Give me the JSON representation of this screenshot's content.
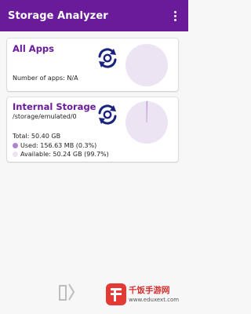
{
  "appbar": {
    "title": "Storage Analyzer",
    "menu_icon": "more-vert-icon"
  },
  "all_apps": {
    "title": "All Apps",
    "count_text": "Number of apps: N/A",
    "icon": "refresh-icon"
  },
  "internal_storage": {
    "title": "Internal Storage",
    "path": "/storage/emulated/0",
    "total": "Total: 50.40 GB",
    "used": "Used: 156.63 MB (0.3%)",
    "available": "Available: 50.24 GB (99.7%)",
    "icon": "refresh-icon"
  },
  "chart_data": {
    "type": "pie",
    "categories": [
      "Used",
      "Available"
    ],
    "values": [
      0.3,
      99.7
    ]
  },
  "colors": {
    "primary": "#6a1b9a",
    "used": "#b084cc",
    "available": "#ece4f3"
  },
  "watermark": {
    "text": "千饭手游网",
    "url": "www.eduxext.com"
  }
}
